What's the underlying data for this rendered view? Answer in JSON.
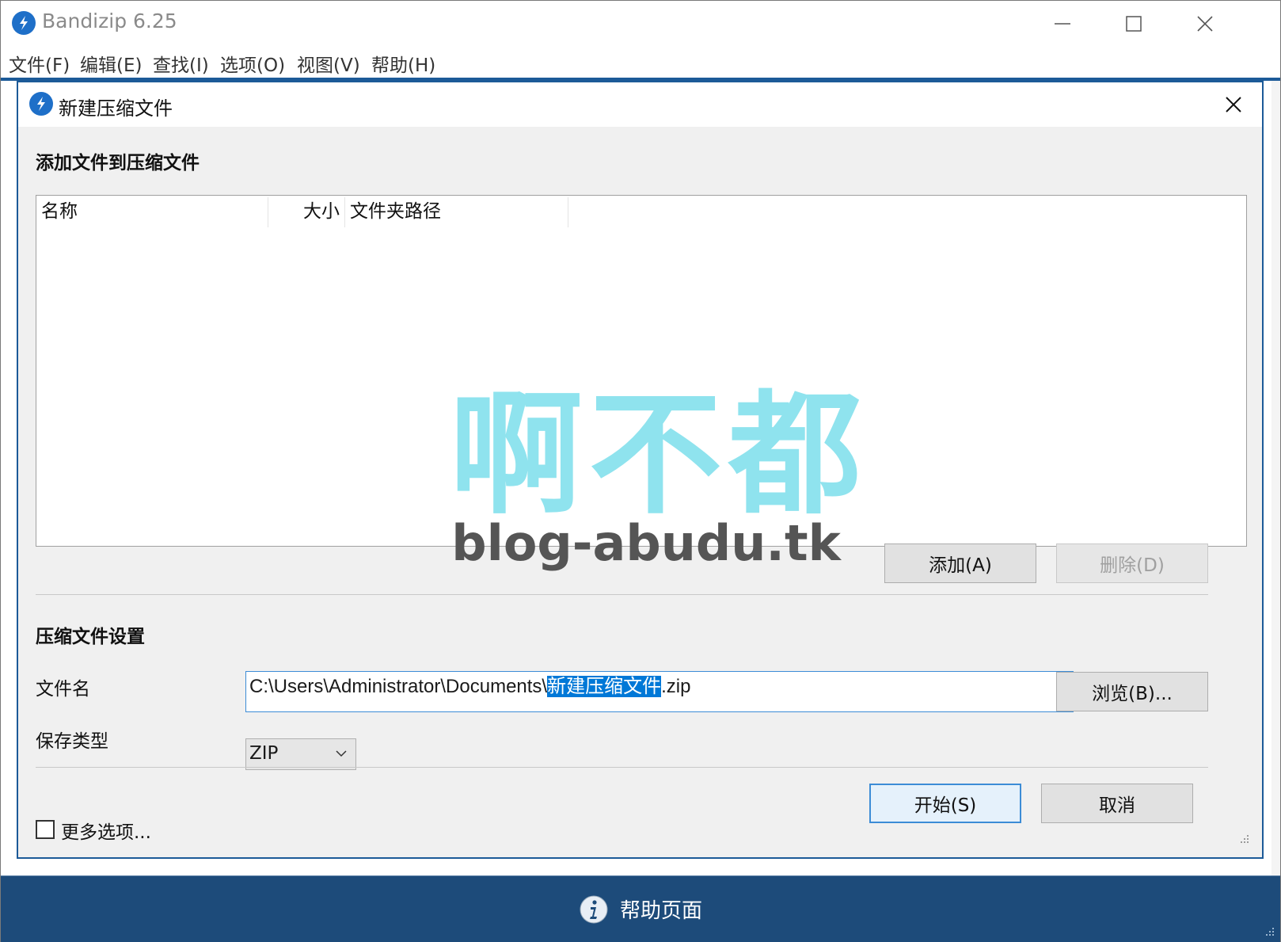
{
  "app": {
    "title": "Bandizip 6.25",
    "menu": [
      "文件(F)",
      "编辑(E)",
      "查找(I)",
      "选项(O)",
      "视图(V)",
      "帮助(H)"
    ],
    "window_controls": [
      "minimize-icon",
      "maximize-icon",
      "close-icon"
    ]
  },
  "dialog": {
    "title": "新建压缩文件",
    "add_section_title": "添加文件到压缩文件",
    "columns": [
      "名称",
      "大小",
      "文件夹路径"
    ],
    "add_button": "添加(A)",
    "delete_button": "删除(D)",
    "delete_enabled": false,
    "settings_title": "压缩文件设置",
    "filename_label": "文件名",
    "filename": {
      "prefix": "C:\\Users\\Administrator\\Documents\\",
      "selected": "新建压缩文件",
      "suffix": ".zip"
    },
    "browse_button": "浏览(B)...",
    "save_type_label": "保存类型",
    "save_type_value": "ZIP",
    "more_options_label": "更多选项...",
    "more_options_checked": false,
    "start_button": "开始(S)",
    "cancel_button": "取消"
  },
  "footer": {
    "help_label": "帮助页面",
    "help_icon": "info-icon"
  },
  "watermark": {
    "text": "啊不都",
    "domain": "blog-abudu.tk"
  },
  "colors": {
    "accent": "#1e6fc8",
    "dialog_border": "#1c5a98",
    "footer_bg": "#1d4b7a",
    "selection": "#0078d7",
    "watermark": "#8fe3ee"
  }
}
